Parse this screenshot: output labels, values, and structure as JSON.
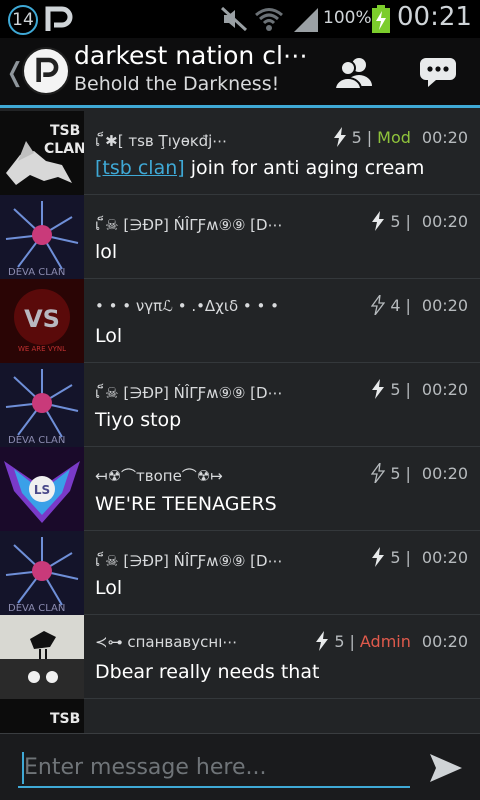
{
  "status_bar": {
    "notification_count": "14",
    "battery_percent": "100%",
    "time": "00:21",
    "icons": [
      "palringo-icon",
      "mute-icon",
      "wifi-icon",
      "signal-icon",
      "battery-charging-icon"
    ]
  },
  "header": {
    "title": "darkest nation cl⋯",
    "subtitle": "Behold the Darkness!",
    "icons": [
      "back-chevron-icon",
      "group-logo-icon",
      "members-icon",
      "chat-icon"
    ]
  },
  "colors": {
    "accent": "#3fa9d6",
    "mod": "#8fc33b",
    "admin": "#e05a4c",
    "background": "#222426"
  },
  "messages": [
    {
      "name": "็เ ็✱[ тѕв Ţıуɵĸđj⋯",
      "level": "5",
      "role": "Mod",
      "time": "00:20",
      "link": "[tsb clan]",
      "text": " join for anti aging cream",
      "avatar": "tsb-clan-avatar"
    },
    {
      "name": "็เ ็☠ [∋ÐP] ŃÎΓƑʍ⑨⑨ [D⋯",
      "level": "5",
      "role": "",
      "time": "00:20",
      "link": "",
      "text": "lol",
      "avatar": "deva-clan-avatar"
    },
    {
      "name": "• • • νγπℒ • .•Δχιδ • • •",
      "level": "4",
      "role": "",
      "time": "00:20",
      "link": "",
      "text": "Lol",
      "avatar": "vs-avatar"
    },
    {
      "name": "็เ ็☠ [∋ÐP] ŃÎΓƑʍ⑨⑨ [D⋯",
      "level": "5",
      "role": "",
      "time": "00:20",
      "link": "",
      "text": "Tiyo stop",
      "avatar": "deva-clan-avatar"
    },
    {
      "name": "↤☢⌒твопе⌒☢↦",
      "level": "5",
      "role": "",
      "time": "00:20",
      "link": "",
      "text": "WE'RE TEENAGERS",
      "avatar": "ls-emblem-avatar"
    },
    {
      "name": "็เ ็☠ [∋ÐP] ŃÎΓƑʍ⑨⑨ [D⋯",
      "level": "5",
      "role": "",
      "time": "00:20",
      "link": "",
      "text": "Lol",
      "avatar": "deva-clan-avatar"
    },
    {
      "name": "≺⊶ спанвавуснı⋯",
      "level": "5",
      "role": "Admin",
      "time": "00:20",
      "link": "",
      "text": "Dbear really needs that",
      "avatar": "bird-avatar"
    },
    {
      "name": "",
      "level": "",
      "role": "",
      "time": "",
      "link": "",
      "text": "",
      "avatar": "tsb-clan-avatar"
    }
  ],
  "input": {
    "placeholder": "Enter message here..."
  }
}
